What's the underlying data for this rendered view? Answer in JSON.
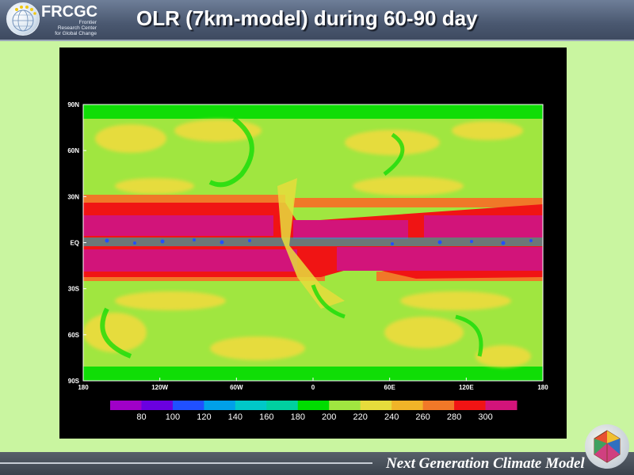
{
  "header": {
    "logo_text": "FRCGC",
    "logo_sub_1": "Frontier",
    "logo_sub_2": "Research Center",
    "logo_sub_3": "for Global Change",
    "title": "OLR (7km-model)  during 60-90 day"
  },
  "map": {
    "lat_labels": [
      "90N",
      "60N",
      "30N",
      "EQ",
      "30S",
      "60S",
      "90S"
    ],
    "lon_labels": [
      "180",
      "120W",
      "60W",
      "0",
      "60E",
      "120E",
      "180"
    ],
    "colorbar_labels": [
      "80",
      "100",
      "120",
      "140",
      "160",
      "180",
      "200",
      "220",
      "240",
      "260",
      "280",
      "300"
    ],
    "colorbar_colors": [
      "#a000c8",
      "#6a00e0",
      "#2050ff",
      "#00a0e8",
      "#00c8c8",
      "#00d0a0",
      "#00dc00",
      "#a0e640",
      "#e6dc3c",
      "#f0b428",
      "#f07828",
      "#f01414",
      "#d2147a"
    ],
    "colors": {
      "background": "#a0e640",
      "band": "#d2147a",
      "band_edge": "#f01414",
      "orange": "#f07828",
      "yellow": "#e6dc3c",
      "green": "#00dc00",
      "cyan": "#00c8c8",
      "blue": "#2050ff"
    }
  },
  "footer": {
    "text": "Next Generation Climate Model"
  }
}
